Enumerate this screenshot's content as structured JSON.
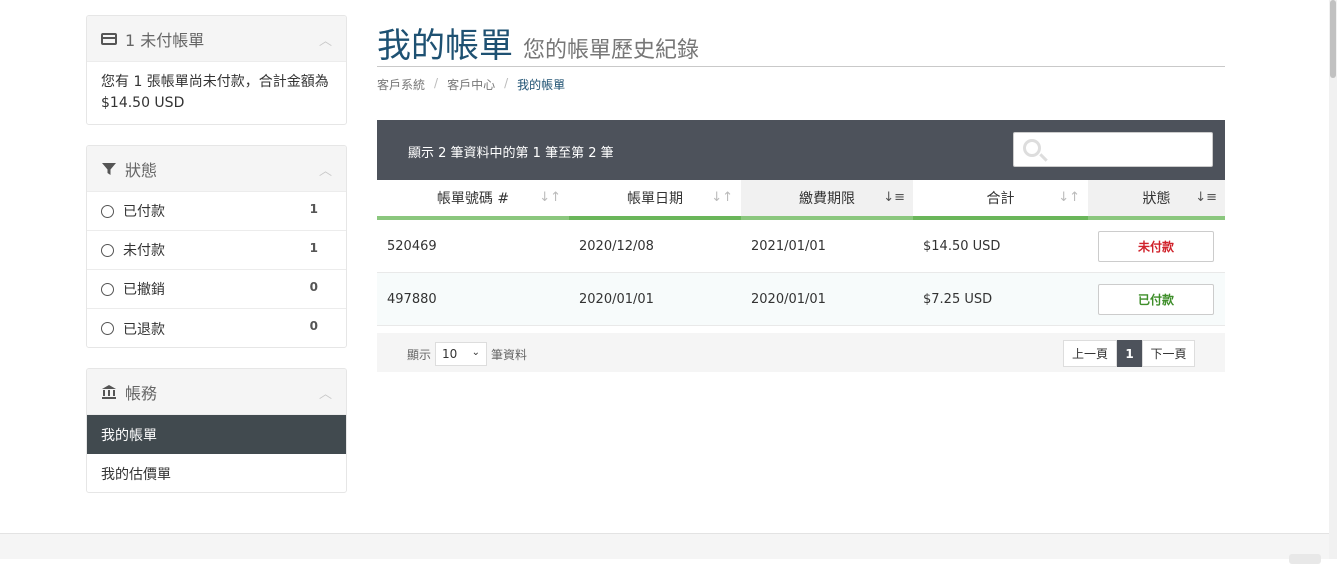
{
  "sidebar": {
    "invoice_panel": {
      "title": "1 未付帳單",
      "body": "您有 1 張帳單尚未付款，合計金額為 $14.50 USD"
    },
    "status_panel": {
      "title": "狀態",
      "items": [
        {
          "label": "已付款",
          "count": "1"
        },
        {
          "label": "未付款",
          "count": "1"
        },
        {
          "label": "已撤銷",
          "count": "0"
        },
        {
          "label": "已退款",
          "count": "0"
        }
      ]
    },
    "billing_panel": {
      "title": "帳務",
      "items": [
        {
          "label": "我的帳單"
        },
        {
          "label": "我的估價單"
        }
      ]
    }
  },
  "page": {
    "title": "我的帳單",
    "subtitle": "您的帳單歷史紀錄",
    "breadcrumb": [
      "客戶系統",
      "客戶中心",
      "我的帳單"
    ]
  },
  "table": {
    "info": "顯示 2 筆資料中的第 1 筆至第 2 筆",
    "columns": [
      "帳單號碼 #",
      "帳單日期",
      "繳費期限",
      "合計",
      "狀態"
    ],
    "rows": [
      {
        "id": "520469",
        "date": "2020/12/08",
        "due": "2021/01/01",
        "total": "$14.50 USD",
        "status": "未付款"
      },
      {
        "id": "497880",
        "date": "2020/01/01",
        "due": "2020/01/01",
        "total": "$7.25 USD",
        "status": "已付款"
      }
    ],
    "footer": {
      "show": "顯示",
      "page_size": "10",
      "records": "筆資料"
    },
    "pager": {
      "prev": "上一頁",
      "current": "1",
      "next": "下一頁"
    }
  },
  "colors": {
    "title": "#1e5172",
    "header_bar": "#4d525b",
    "accent_green": "#8bc77e",
    "unpaid": "#d0222b",
    "paid": "#3e8e2a",
    "active_nav": "#414a4f"
  }
}
